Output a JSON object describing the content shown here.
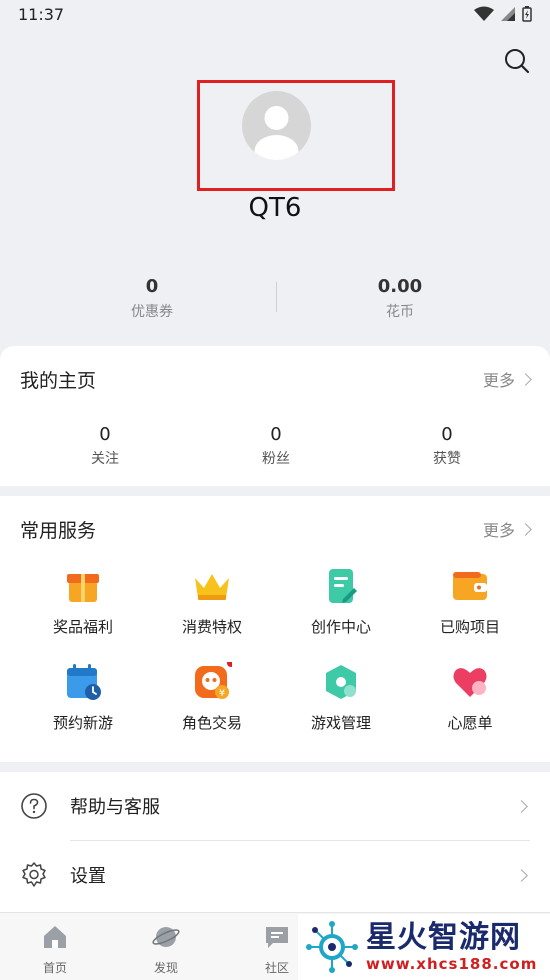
{
  "status_bar": {
    "time": "11:37"
  },
  "profile": {
    "username": "QT6"
  },
  "stats": [
    {
      "value": "0",
      "label": "优惠券"
    },
    {
      "value": "0.00",
      "label": "花币"
    }
  ],
  "homepage": {
    "title": "我的主页",
    "more": "更多",
    "stats": [
      {
        "value": "0",
        "label": "关注"
      },
      {
        "value": "0",
        "label": "粉丝"
      },
      {
        "value": "0",
        "label": "获赞"
      }
    ]
  },
  "services": {
    "title": "常用服务",
    "more": "更多",
    "items": [
      {
        "label": "奖品福利",
        "icon": "gift-icon"
      },
      {
        "label": "消费特权",
        "icon": "crown-icon"
      },
      {
        "label": "创作中心",
        "icon": "document-edit-icon"
      },
      {
        "label": "已购项目",
        "icon": "wallet-icon"
      },
      {
        "label": "预约新游",
        "icon": "calendar-clock-icon"
      },
      {
        "label": "角色交易",
        "icon": "role-trade-icon"
      },
      {
        "label": "游戏管理",
        "icon": "game-manage-icon"
      },
      {
        "label": "心愿单",
        "icon": "heart-icon"
      }
    ]
  },
  "menu": [
    {
      "label": "帮助与客服",
      "icon": "help-icon"
    },
    {
      "label": "设置",
      "icon": "gear-icon"
    }
  ],
  "tabs": [
    {
      "label": "首页",
      "icon": "home-icon"
    },
    {
      "label": "发现",
      "icon": "planet-icon"
    },
    {
      "label": "社区",
      "icon": "chat-icon"
    }
  ],
  "watermark": {
    "main": "星火智游网",
    "sub": "www.xhcs188.com"
  },
  "colors": {
    "accent_red": "#e02020",
    "background": "#eef0f3",
    "card": "#ffffff"
  }
}
